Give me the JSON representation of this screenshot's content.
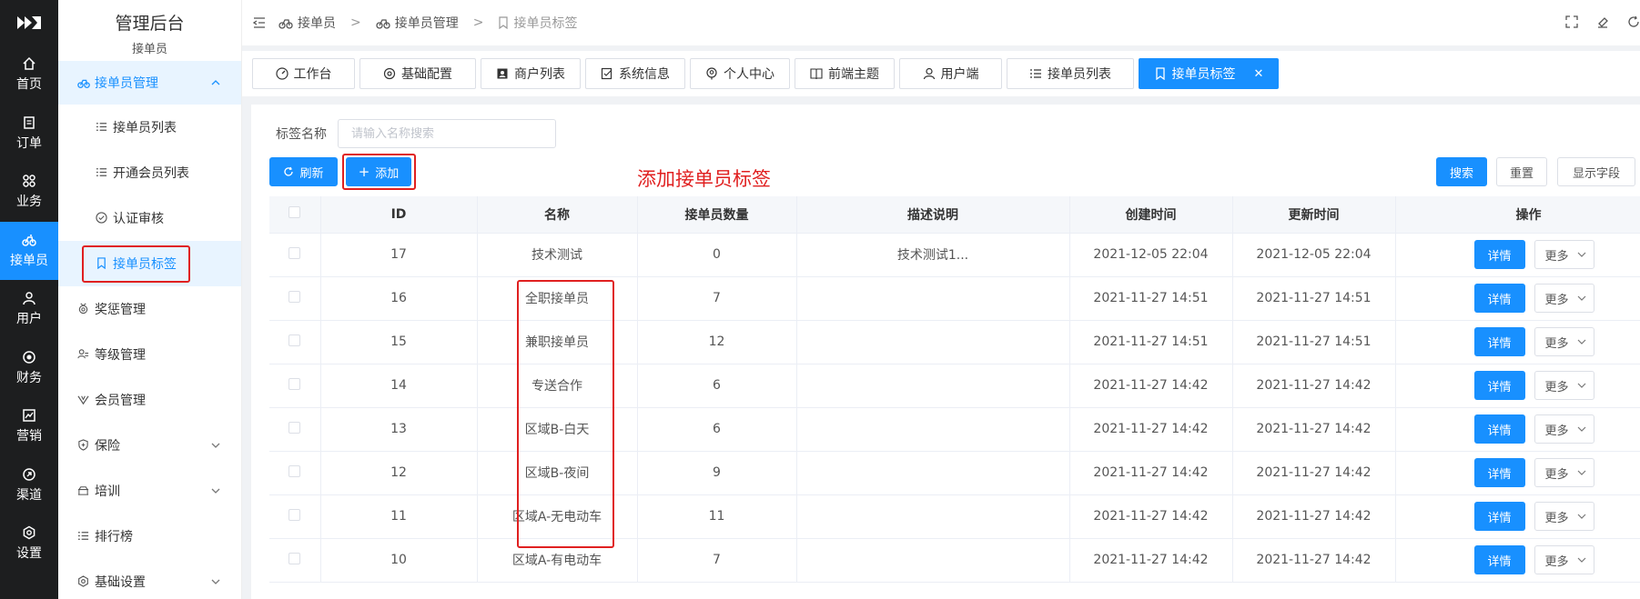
{
  "app": {
    "title": "管理后台",
    "subtitle": "接单员"
  },
  "rail": {
    "items": [
      {
        "label": "首页",
        "icon": "home-icon"
      },
      {
        "label": "订单",
        "icon": "order-icon"
      },
      {
        "label": "业务",
        "icon": "business-icon"
      },
      {
        "label": "接单员",
        "icon": "bike-icon",
        "active": true
      },
      {
        "label": "用户",
        "icon": "user-icon"
      },
      {
        "label": "财务",
        "icon": "finance-icon"
      },
      {
        "label": "营销",
        "icon": "marketing-icon"
      },
      {
        "label": "渠道",
        "icon": "channel-icon"
      },
      {
        "label": "设置",
        "icon": "settings-icon"
      }
    ]
  },
  "menu": {
    "group": "接单员管理",
    "sub_items": [
      "接单员列表",
      "开通会员列表",
      "认证审核",
      "接单员标签"
    ],
    "items": [
      "奖惩管理",
      "等级管理",
      "会员管理",
      "保险",
      "培训",
      "排行榜",
      "基础设置"
    ]
  },
  "breadcrumb": [
    "接单员",
    "接单员管理",
    "接单员标签"
  ],
  "tabs": [
    "工作台",
    "基础配置",
    "商户列表",
    "系统信息",
    "个人中心",
    "前端主题",
    "用户端",
    "接单员列表",
    "接单员标签"
  ],
  "filter": {
    "label": "标签名称",
    "placeholder": "请输入名称搜索"
  },
  "toolbar": {
    "refresh": "刷新",
    "add": "添加",
    "search": "搜索",
    "reset": "重置",
    "columns": "显示字段"
  },
  "annotation": "添加接单员标签",
  "table": {
    "headers": [
      "ID",
      "名称",
      "接单员数量",
      "描述说明",
      "创建时间",
      "更新时间",
      "操作"
    ],
    "rows": [
      {
        "id": "17",
        "name": "技术测试",
        "count": "0",
        "desc": "技术测试1...",
        "created": "2021-12-05 22:04",
        "updated": "2021-12-05 22:04"
      },
      {
        "id": "16",
        "name": "全职接单员",
        "count": "7",
        "desc": "",
        "created": "2021-11-27 14:51",
        "updated": "2021-11-27 14:51"
      },
      {
        "id": "15",
        "name": "兼职接单员",
        "count": "12",
        "desc": "",
        "created": "2021-11-27 14:51",
        "updated": "2021-11-27 14:51"
      },
      {
        "id": "14",
        "name": "专送合作",
        "count": "6",
        "desc": "",
        "created": "2021-11-27 14:42",
        "updated": "2021-11-27 14:42"
      },
      {
        "id": "13",
        "name": "区域B-白天",
        "count": "6",
        "desc": "",
        "created": "2021-11-27 14:42",
        "updated": "2021-11-27 14:42"
      },
      {
        "id": "12",
        "name": "区域B-夜间",
        "count": "9",
        "desc": "",
        "created": "2021-11-27 14:42",
        "updated": "2021-11-27 14:42"
      },
      {
        "id": "11",
        "name": "区域A-无电动车",
        "count": "11",
        "desc": "",
        "created": "2021-11-27 14:42",
        "updated": "2021-11-27 14:42"
      },
      {
        "id": "10",
        "name": "区域A-有电动车",
        "count": "7",
        "desc": "",
        "created": "2021-11-27 14:42",
        "updated": "2021-11-27 14:42"
      }
    ],
    "detail_label": "详情",
    "more_label": "更多"
  },
  "colors": {
    "primary": "#1890ff",
    "rail_bg": "#1d1e1f",
    "annotation": "#e02020"
  }
}
